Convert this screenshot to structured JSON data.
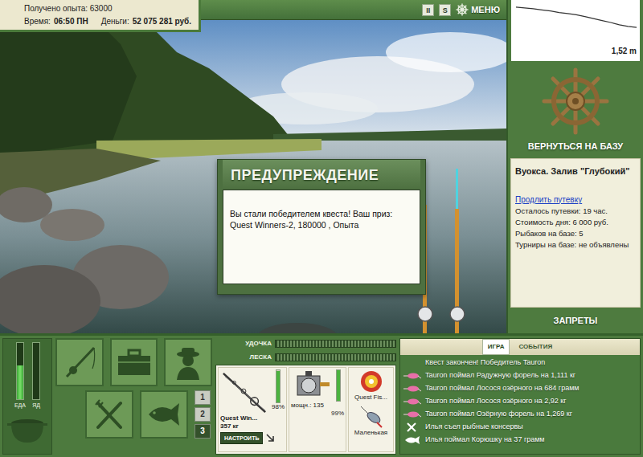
{
  "status": {
    "experience": "Получено опыта: 63000",
    "time_label": "Время:",
    "time": "06:50 ПН",
    "money_label": "Деньги:",
    "money": "52 075 281 руб."
  },
  "toolbar": {
    "pause": "II",
    "sound": "S",
    "menu": "МЕНЮ"
  },
  "depth": {
    "reading": "1,52 m",
    "profile": [
      0.2,
      0.25,
      0.3,
      0.38,
      0.45,
      0.55,
      0.62,
      0.7,
      0.82,
      0.95,
      1.08,
      1.2,
      1.35,
      1.45,
      1.52
    ]
  },
  "dialog": {
    "title": "ПРЕДУПРЕЖДЕНИЕ",
    "message": "Вы стали победителем квеста! Ваш приз: Quest Winners-2, 180000 , Опыта"
  },
  "base": {
    "return": "ВЕРНУТЬСЯ НА БАЗУ",
    "location": "Вуокса. Залив \"Глубокий\"",
    "extend": "Продлить путевку",
    "facts": [
      "Осталось путевки: 19 час.",
      "Стоимость дня: 6 000 руб.",
      "Рыбаков на базе: 5",
      "Турниры на базе: не объявлены"
    ],
    "bans": "ЗАПРЕТЫ"
  },
  "needs": [
    {
      "label": "ЕДА",
      "level": 0.6
    },
    {
      "label": "ЯД",
      "level": 0.0
    }
  ],
  "pages": [
    {
      "label": "1",
      "selected": false
    },
    {
      "label": "2",
      "selected": false
    },
    {
      "label": "3",
      "selected": true
    }
  ],
  "tension": [
    {
      "label": "УДОЧКА",
      "level": 0.0
    },
    {
      "label": "ЛЕСКА",
      "level": 0.0
    }
  ],
  "rod": {
    "name": "Quest Win...",
    "weight": "357 кг",
    "condition": "98%",
    "level": 0.98,
    "button": "НАСТРОИТЬ"
  },
  "reel": {
    "power": "мощн.: 135",
    "condition": "99%",
    "level": 0.99
  },
  "line": {
    "name": "Quest Fis..."
  },
  "lure": {
    "name": "Маленькая"
  },
  "events": {
    "tabs": [
      {
        "label": "ИГРА",
        "selected": true
      },
      {
        "label": "СОБЫТИЯ",
        "selected": false
      }
    ],
    "items": [
      {
        "text": "Квест закончен! Победитель Tauron",
        "kind": "notice"
      },
      {
        "text": "Tauron поймал Радужную форель на 1,111 кг",
        "kind": "catch"
      },
      {
        "text": "Tauron поймал Лосося озёрного на 684 грамм",
        "kind": "catch"
      },
      {
        "text": "Tauron поймал Лосося озёрного на 2,92 кг",
        "kind": "catch"
      },
      {
        "text": "Tauron поймал Озёрную форель на 1,269 кг",
        "kind": "catch"
      },
      {
        "text": "Илья съел рыбные консервы",
        "kind": "eat"
      },
      {
        "text": "Илья поймал Корюшку на 37 грамм",
        "kind": "fish"
      }
    ]
  }
}
